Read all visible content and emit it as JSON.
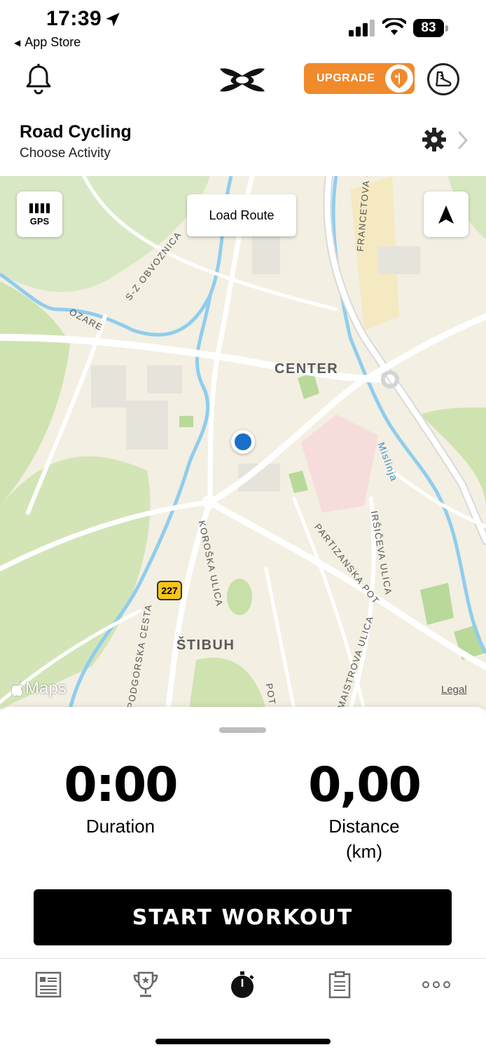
{
  "status_bar": {
    "time": "17:39",
    "back_app": "App Store",
    "battery": "83"
  },
  "top_nav": {
    "upgrade_label": "UPGRADE"
  },
  "activity": {
    "title": "Road Cycling",
    "subtitle": "Choose Activity"
  },
  "map": {
    "gps_label": "GPS",
    "load_route_label": "Load Route",
    "labels": {
      "center": "CENTER",
      "stibuh": "ŠTIBUH",
      "obvoznica": "S-Z OBVOZNICA",
      "ozare": "OZARE",
      "francetova": "FRANCETOVA C",
      "mislinja": "Mislinja",
      "partizanska": "PARTIZANSKA POT",
      "irsiceva": "IRŠIČEVA ULICA",
      "koroska": "KOROŠKA ULICA",
      "podgorska": "PODGORSKA CESTA",
      "maistrova": "MAISTROVA ULICA",
      "pot": "POT OB"
    },
    "road_shield": "227",
    "attribution": "Maps",
    "legal": "Legal"
  },
  "stats": {
    "duration_value": "0:00",
    "duration_label": "Duration",
    "distance_value": "0,00",
    "distance_label": "Distance",
    "distance_unit": "(km)"
  },
  "start_button": "START WORKOUT",
  "tabs": [
    {
      "icon": "feed-icon"
    },
    {
      "icon": "trophy-icon"
    },
    {
      "icon": "stopwatch-icon"
    },
    {
      "icon": "clipboard-icon"
    },
    {
      "icon": "more-icon"
    }
  ],
  "colors": {
    "accent": "#f08a2b",
    "location": "#1a6fc9",
    "map_bg": "#f3efe2",
    "water": "#7fc3ea",
    "park": "#cfe3b0"
  }
}
